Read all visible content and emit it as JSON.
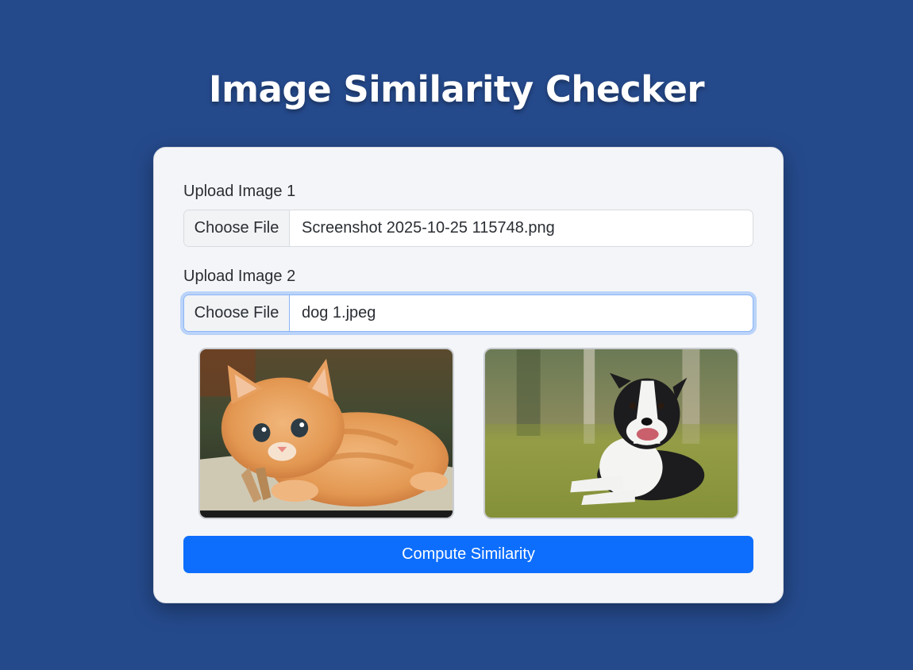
{
  "page": {
    "title": "Image Similarity Checker"
  },
  "upload1": {
    "label": "Upload Image 1",
    "button_label": "Choose File",
    "file_name": "Screenshot 2025-10-25 115748.png"
  },
  "upload2": {
    "label": "Upload Image 2",
    "button_label": "Choose File",
    "file_name": "dog 1.jpeg"
  },
  "previews": {
    "image1": "orange kitten photo",
    "image2": "border collie dog photo"
  },
  "compute": {
    "label": "Compute Similarity"
  },
  "colors": {
    "background": "#254a8c",
    "card": "#f4f5f8",
    "primary": "#0d6efd"
  }
}
